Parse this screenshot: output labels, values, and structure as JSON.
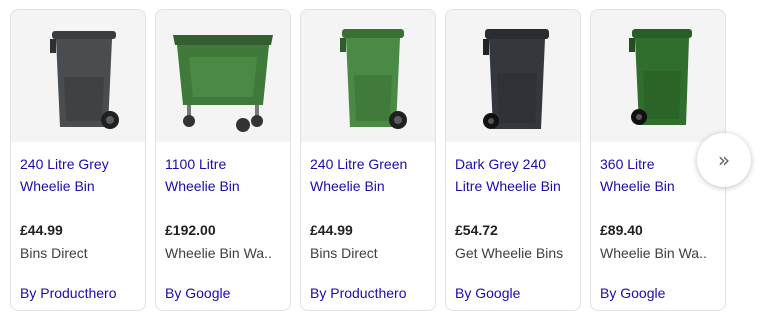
{
  "products": [
    {
      "title_lines": [
        "240 Litre Grey",
        "Wheelie Bin"
      ],
      "price": "£44.99",
      "merchant": "Bins Direct",
      "source": "By Producthero",
      "image": "grey-wheelie-bin",
      "color": "#4a4d4f"
    },
    {
      "title_lines": [
        "1100 Litre",
        "Wheelie Bin"
      ],
      "price": "£192.00",
      "merchant": "Wheelie Bin Wa..",
      "source": "By Google",
      "image": "large-green-wheelie-bin",
      "color": "#3f7a3a"
    },
    {
      "title_lines": [
        "240 Litre Green",
        "Wheelie Bin"
      ],
      "price": "£44.99",
      "merchant": "Bins Direct",
      "source": "By Producthero",
      "image": "green-wheelie-bin",
      "color": "#4a8a44"
    },
    {
      "title_lines": [
        "Dark Grey 240",
        "Litre Wheelie Bin"
      ],
      "price": "£54.72",
      "merchant": "Get Wheelie Bins",
      "source": "By Google",
      "image": "dark-grey-wheelie-bin",
      "color": "#34383c"
    },
    {
      "title_lines": [
        "360 Litre",
        "Wheelie Bin"
      ],
      "price": "£89.40",
      "merchant": "Wheelie Bin Wa..",
      "source": "By Google",
      "image": "green-wheelie-bin-360",
      "color": "#2f6e2c"
    }
  ],
  "next_button": {
    "icon": "double-chevron-right-icon",
    "glyph": "»"
  }
}
